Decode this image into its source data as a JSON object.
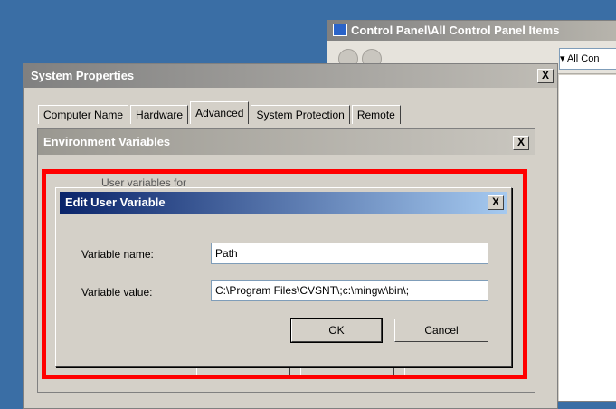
{
  "control_panel": {
    "title": "Control Panel\\All Control Panel Items",
    "address": "▾ All Con"
  },
  "system_properties": {
    "title": "System Properties",
    "close_label": "X",
    "tabs": [
      {
        "label": "Computer Name"
      },
      {
        "label": "Hardware"
      },
      {
        "label": "Advanced"
      },
      {
        "label": "System Protection"
      },
      {
        "label": "Remote"
      }
    ]
  },
  "environment_variables": {
    "title": "Environment Variables",
    "close_label": "X",
    "hint": "User variables for"
  },
  "edit_user_variable": {
    "title": "Edit User Variable",
    "close_label": "X",
    "name_label": "Variable name:",
    "name_value": "Path",
    "value_label": "Variable value:",
    "value_value": "C:\\Program Files\\CVSNT\\;c:\\mingw\\bin\\;",
    "ok_label": "OK",
    "cancel_label": "Cancel"
  },
  "colors": {
    "highlight": "#ff0000",
    "active_title": "#0a246a",
    "desktop": "#3a6ea5"
  }
}
